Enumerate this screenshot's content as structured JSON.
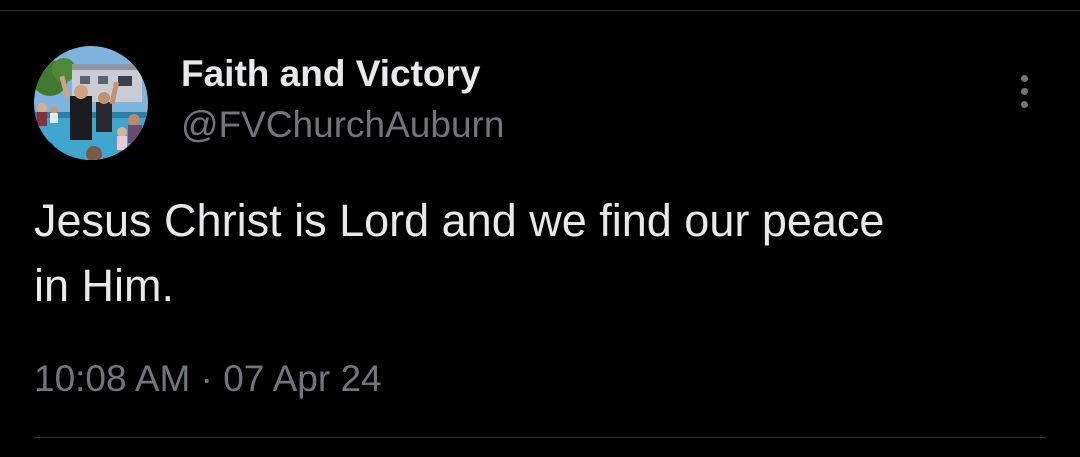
{
  "tweet": {
    "author": {
      "display_name": "Faith and Victory",
      "handle": "@FVChurchAuburn",
      "avatar": "photo-avatar"
    },
    "text": "Jesus Christ is Lord and we find our peace\nin Him.",
    "timestamp": "10:08 AM · 07 Apr 24",
    "menu_icon": "more-vertical-icon"
  },
  "colors": {
    "background": "#000000",
    "primary_text": "#e7e9ea",
    "secondary_text": "#71767b",
    "divider": "#2f3336"
  }
}
